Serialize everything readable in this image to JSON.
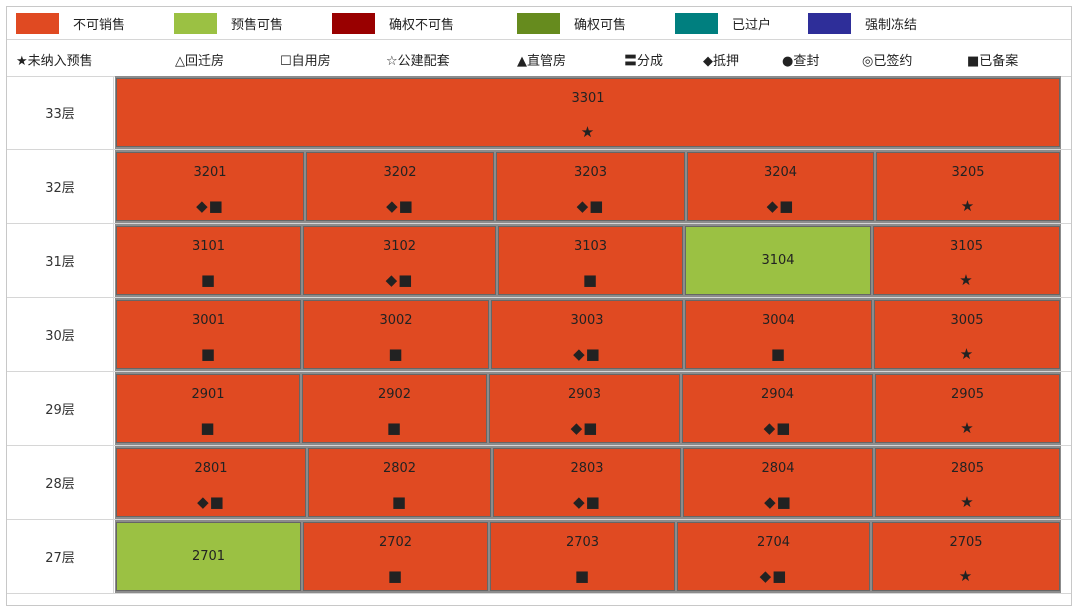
{
  "status_legend": [
    {
      "label": "不可销售",
      "color": "#e04a22",
      "icon": "swatch-not-for-sale"
    },
    {
      "label": "预售可售",
      "color": "#9bc143",
      "icon": "swatch-presale-available"
    },
    {
      "label": "确权不可售",
      "color": "#990000",
      "icon": "swatch-confirmed-not-for-sale"
    },
    {
      "label": "确权可售",
      "color": "#668b1e",
      "icon": "swatch-confirmed-available"
    },
    {
      "label": "已过户",
      "color": "#007f7f",
      "icon": "swatch-transferred"
    },
    {
      "label": "强制冻结",
      "color": "#2e2e99",
      "icon": "swatch-frozen"
    }
  ],
  "mark_legend": [
    "★未纳入预售",
    "△回迁房",
    "☐自用房",
    "☆公建配套",
    "▲直管房",
    "〓分成",
    "◆抵押",
    "●查封",
    "◎已签约",
    "■已备案"
  ],
  "floors": [
    {
      "label": "33层",
      "units": [
        {
          "no": "3301",
          "status": "#e04a22",
          "mark": "★"
        }
      ]
    },
    {
      "label": "32层",
      "units": [
        {
          "no": "3201",
          "status": "#e04a22",
          "mark": "◆■"
        },
        {
          "no": "3202",
          "status": "#e04a22",
          "mark": "◆■"
        },
        {
          "no": "3203",
          "status": "#e04a22",
          "mark": "◆■"
        },
        {
          "no": "3204",
          "status": "#e04a22",
          "mark": "◆■"
        },
        {
          "no": "3205",
          "status": "#e04a22",
          "mark": "★"
        }
      ]
    },
    {
      "label": "31层",
      "units": [
        {
          "no": "3101",
          "status": "#e04a22",
          "mark": "■"
        },
        {
          "no": "3102",
          "status": "#e04a22",
          "mark": "◆■"
        },
        {
          "no": "3103",
          "status": "#e04a22",
          "mark": "■"
        },
        {
          "no": "3104",
          "status": "#9bc143",
          "mark": ""
        },
        {
          "no": "3105",
          "status": "#e04a22",
          "mark": "★"
        }
      ]
    },
    {
      "label": "30层",
      "units": [
        {
          "no": "3001",
          "status": "#e04a22",
          "mark": "■"
        },
        {
          "no": "3002",
          "status": "#e04a22",
          "mark": "■"
        },
        {
          "no": "3003",
          "status": "#e04a22",
          "mark": "◆■"
        },
        {
          "no": "3004",
          "status": "#e04a22",
          "mark": "■"
        },
        {
          "no": "3005",
          "status": "#e04a22",
          "mark": "★"
        }
      ]
    },
    {
      "label": "29层",
      "units": [
        {
          "no": "2901",
          "status": "#e04a22",
          "mark": "■"
        },
        {
          "no": "2902",
          "status": "#e04a22",
          "mark": "■"
        },
        {
          "no": "2903",
          "status": "#e04a22",
          "mark": "◆■"
        },
        {
          "no": "2904",
          "status": "#e04a22",
          "mark": "◆■"
        },
        {
          "no": "2905",
          "status": "#e04a22",
          "mark": "★"
        }
      ]
    },
    {
      "label": "28层",
      "units": [
        {
          "no": "2801",
          "status": "#e04a22",
          "mark": "◆■"
        },
        {
          "no": "2802",
          "status": "#e04a22",
          "mark": "■"
        },
        {
          "no": "2803",
          "status": "#e04a22",
          "mark": "◆■"
        },
        {
          "no": "2804",
          "status": "#e04a22",
          "mark": "◆■"
        },
        {
          "no": "2805",
          "status": "#e04a22",
          "mark": "★"
        }
      ]
    },
    {
      "label": "27层",
      "units": [
        {
          "no": "2701",
          "status": "#9bc143",
          "mark": ""
        },
        {
          "no": "2702",
          "status": "#e04a22",
          "mark": "■"
        },
        {
          "no": "2703",
          "status": "#e04a22",
          "mark": "■"
        },
        {
          "no": "2704",
          "status": "#e04a22",
          "mark": "◆■"
        },
        {
          "no": "2705",
          "status": "#e04a22",
          "mark": "★"
        }
      ]
    }
  ]
}
